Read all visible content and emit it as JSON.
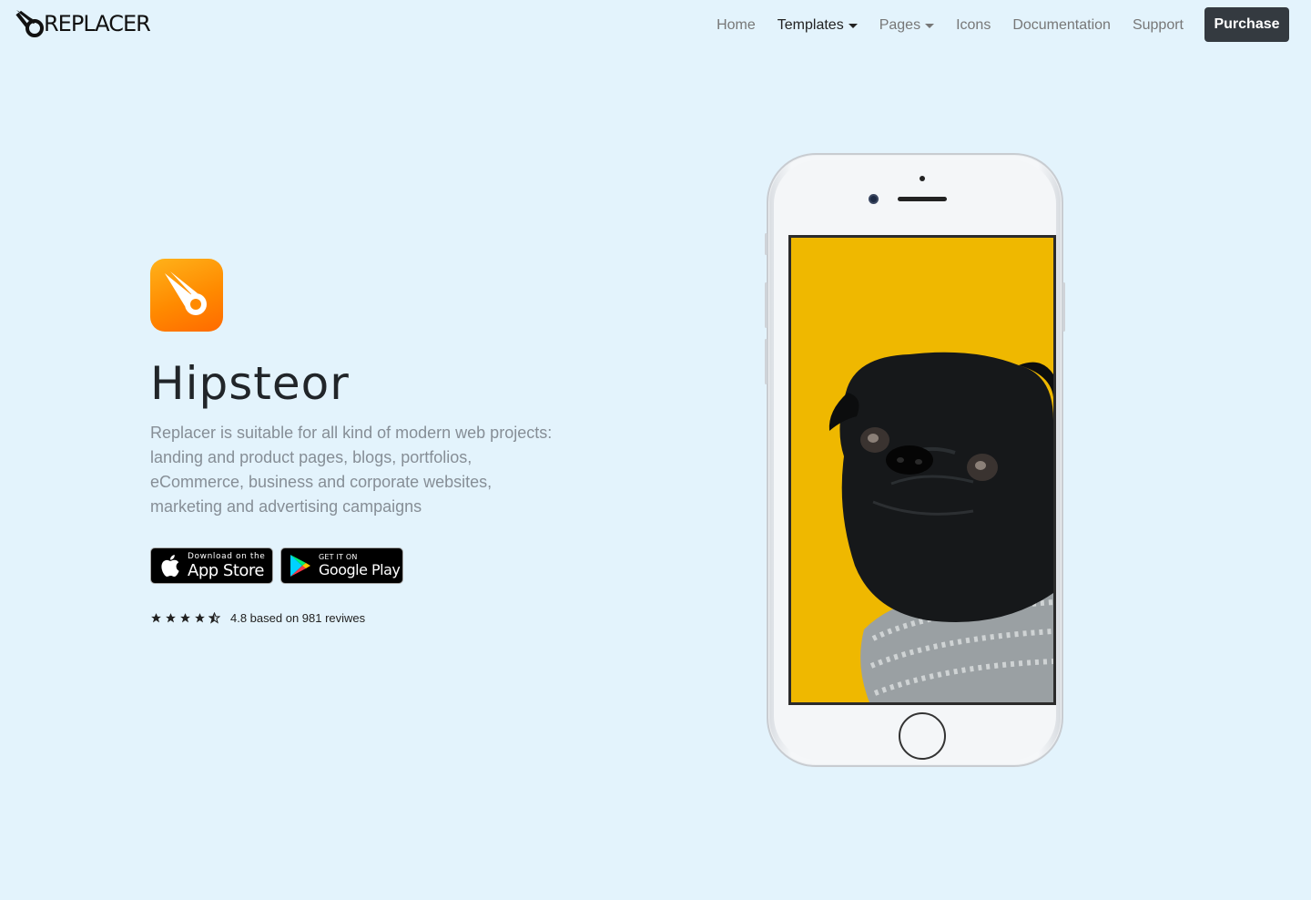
{
  "brand": {
    "name": "REPLACER"
  },
  "nav": {
    "items": [
      {
        "label": "Home",
        "active": false,
        "dropdown": false
      },
      {
        "label": "Templates",
        "active": true,
        "dropdown": true
      },
      {
        "label": "Pages",
        "active": false,
        "dropdown": true
      },
      {
        "label": "Icons",
        "active": false,
        "dropdown": false
      },
      {
        "label": "Documentation",
        "active": false,
        "dropdown": false
      },
      {
        "label": "Support",
        "active": false,
        "dropdown": false
      }
    ],
    "purchase_label": "Purchase"
  },
  "hero": {
    "app_icon": "meteor-icon",
    "title": "Hipsteor",
    "description": "Replacer is suitable for all kind of modern web projects: landing and product pages, blogs, portfolios, eCommerce, business and corporate websites, marketing and advertising campaigns",
    "app_store": {
      "small": "Download on the",
      "big": "App Store"
    },
    "google_play": {
      "small": "GET IT ON",
      "big": "Google Play"
    },
    "rating": {
      "stars": 4.5,
      "text": "4.8 based on 981 reviwes"
    }
  },
  "phone": {
    "screen_image": "pug-in-scarf-photo",
    "screen_bg": "#efb800"
  },
  "colors": {
    "background": "#e3f3fc",
    "purchase_button": "#343a40",
    "accent_orange": "#ff8a00"
  }
}
